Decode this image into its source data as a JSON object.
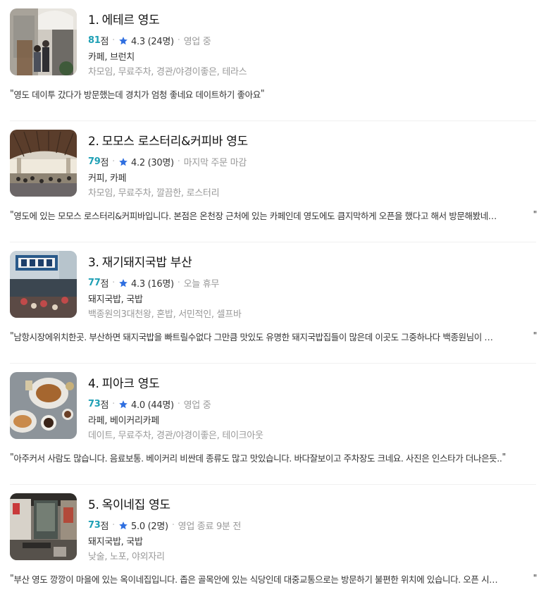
{
  "places": [
    {
      "rank": "1.",
      "name": "에테르 영도",
      "score": "81",
      "score_unit": "점",
      "rating": "4.3 (24명)",
      "status": "영업 중",
      "category": "카페, 브런치",
      "tags": "차모임, 무료주차, 경관/야경이좋은, 테라스",
      "review": "영도 데이투 갔다가 방문했는데 경치가 엄청 좋네요 데이트하기 좋아요",
      "quote_open": "\"",
      "quote_close": "\"",
      "thumb_icon": "cafe-interior-photo"
    },
    {
      "rank": "2.",
      "name": "모모스 로스터리&커피바 영도",
      "score": "79",
      "score_unit": "점",
      "rating": "4.2 (30명)",
      "status": "마지막 주문 마감",
      "category": "커피, 카페",
      "tags": "차모임, 무료주차, 깔끔한, 로스터리",
      "review": "영도에 있는 모모스 로스터리&커피바입니다. 본점은 온천장 근처에 있는 카페인데 영도에도 큼지막하게 오픈을 했다고 해서 방문해봤네…",
      "quote_open": "\"",
      "quote_close": "\"",
      "thumb_icon": "roastery-hall-photo"
    },
    {
      "rank": "3.",
      "name": "재기돼지국밥 부산",
      "score": "77",
      "score_unit": "점",
      "rating": "4.3 (16명)",
      "status": "오늘 휴무",
      "category": "돼지국밥, 국밥",
      "tags": "백종원의3대천왕, 혼밥, 서민적인, 셀프바",
      "review": "남항시장에위치한곳. 부산하면 돼지국밥을 빠트릴수없다 그만큼 맛있도 유명한 돼지국밥집들이 많은데 이곳도 그중하나다 백종원님이 …",
      "quote_open": "\"",
      "quote_close": "\"",
      "thumb_icon": "market-street-photo"
    },
    {
      "rank": "4.",
      "name": "피아크 영도",
      "score": "73",
      "score_unit": "점",
      "rating": "4.0 (44명)",
      "status": "영업 중",
      "category": "라페, 베이커리카페",
      "tags": "데이트, 무료주차, 경관/야경이좋은, 테이크아웃",
      "review": "아주커서 사람도 많습니다. 음료보통. 베이커리 비싼데 종류도 많고 맛있습니다. 바다잘보이고 주차장도 크네요. 사진은 인스타가 더나은듯..",
      "quote_open": "\"",
      "quote_close": "\"",
      "thumb_icon": "bakery-table-photo"
    },
    {
      "rank": "5.",
      "name": "옥이네집 영도",
      "score": "73",
      "score_unit": "점",
      "rating": "5.0 (2명)",
      "status": "영업 종료 9분 전",
      "category": "돼지국밥, 국밥",
      "tags": "낮술, 노포, 야외자리",
      "review": "부산 영도 깡깡이 마을에 있는 옥이네집입니다. 좁은 골목안에 있는 식당인데 대중교통으로는 방문하기 불편한 위치에 있습니다. 오픈 시…",
      "quote_open": "\"",
      "quote_close": "\"",
      "thumb_icon": "alley-restaurant-photo"
    }
  ],
  "colors": {
    "score": "#1fa0b5",
    "star": "#2f6fe0",
    "muted": "#999999",
    "divider": "#f0f0f0"
  }
}
